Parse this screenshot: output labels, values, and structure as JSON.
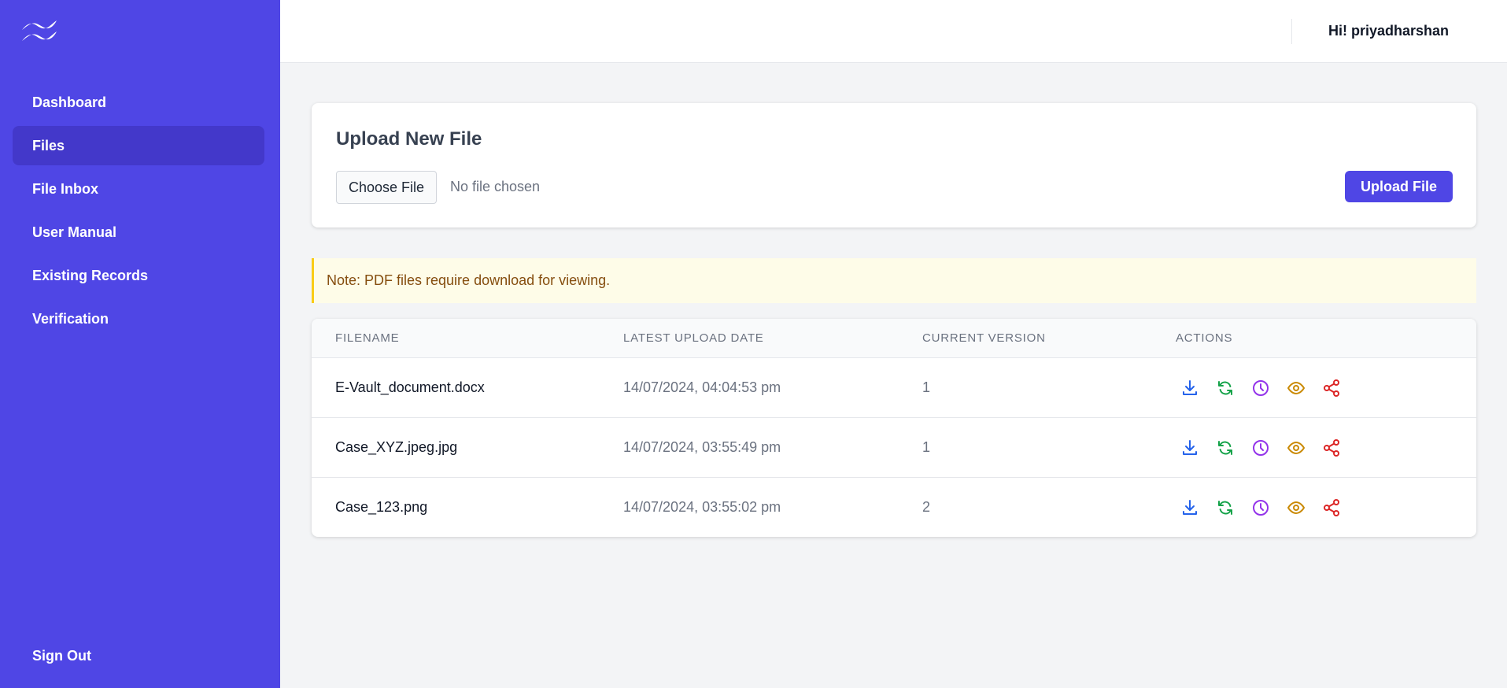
{
  "sidebar": {
    "items": [
      {
        "label": "Dashboard",
        "active": false
      },
      {
        "label": "Files",
        "active": true
      },
      {
        "label": "File Inbox",
        "active": false
      },
      {
        "label": "User Manual",
        "active": false
      },
      {
        "label": "Existing Records",
        "active": false
      },
      {
        "label": "Verification",
        "active": false
      }
    ],
    "sign_out": "Sign Out"
  },
  "header": {
    "greeting": "Hi! priyadharshan"
  },
  "upload": {
    "title": "Upload New File",
    "choose_label": "Choose File",
    "no_file_text": "No file chosen",
    "upload_label": "Upload File"
  },
  "note": "Note: PDF files require download for viewing.",
  "table": {
    "columns": [
      "FILENAME",
      "LATEST UPLOAD DATE",
      "CURRENT VERSION",
      "ACTIONS"
    ],
    "rows": [
      {
        "filename": "E-Vault_document.docx",
        "date": "14/07/2024, 04:04:53 pm",
        "version": "1"
      },
      {
        "filename": "Case_XYZ.jpeg.jpg",
        "date": "14/07/2024, 03:55:49 pm",
        "version": "1"
      },
      {
        "filename": "Case_123.png",
        "date": "14/07/2024, 03:55:02 pm",
        "version": "2"
      }
    ],
    "action_icons": [
      "download-icon",
      "refresh-icon",
      "clock-icon",
      "eye-icon",
      "share-icon"
    ]
  },
  "colors": {
    "brand": "#4f46e5",
    "brand_active": "#4338ca",
    "download": "#2563eb",
    "refresh": "#16a34a",
    "history": "#9333ea",
    "view": "#ca8a04",
    "share": "#dc2626"
  }
}
